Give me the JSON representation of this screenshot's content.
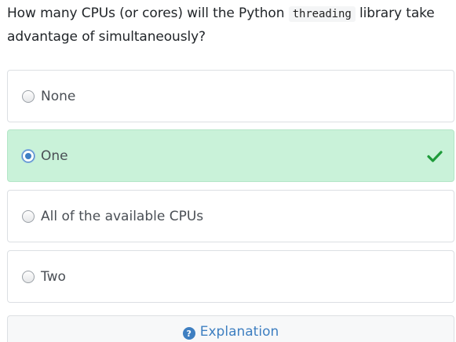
{
  "question": {
    "before": "How many CPUs (or cores) will the Python ",
    "code": "threading",
    "after": " library take advantage of simultaneously?"
  },
  "options": [
    {
      "label": "None",
      "selected": false,
      "correct": false
    },
    {
      "label": "One",
      "selected": true,
      "correct": true
    },
    {
      "label": "All of the available CPUs",
      "selected": false,
      "correct": false
    },
    {
      "label": "Two",
      "selected": false,
      "correct": false
    }
  ],
  "explanation": {
    "label": "Explanation",
    "icon": "question-circle-icon"
  },
  "colors": {
    "correct_bg": "#c9f2d9",
    "check": "#1e9b3a",
    "accent": "#3e7fc1"
  },
  "icons": {
    "correct_mark": "check-icon"
  }
}
